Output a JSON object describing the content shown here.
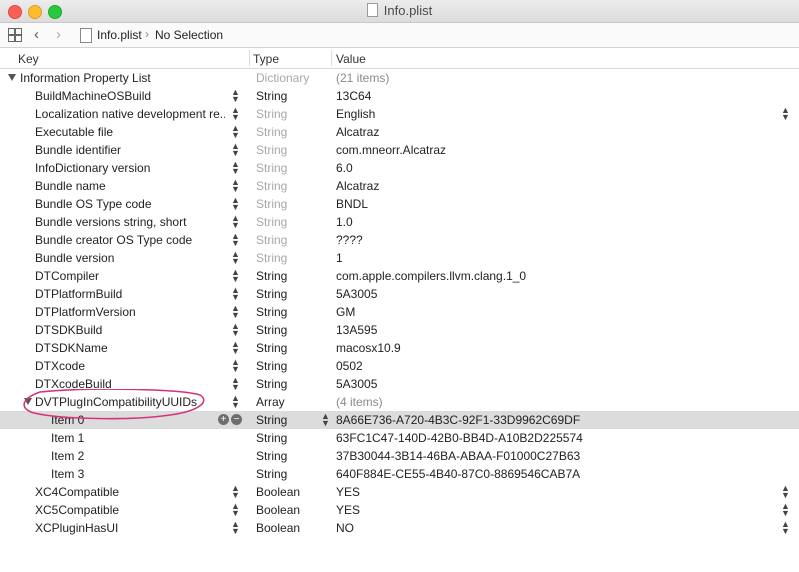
{
  "window": {
    "title": "Info.plist"
  },
  "jumpbar": {
    "file": "Info.plist",
    "separator": "›",
    "selection": "No Selection"
  },
  "columns": {
    "key": "Key",
    "type": "Type",
    "value": "Value"
  },
  "rows": [
    {
      "key": "Information Property List",
      "type": "Dictionary",
      "value": "(21 items)"
    },
    {
      "key": "BuildMachineOSBuild",
      "type": "String",
      "value": "13C64"
    },
    {
      "key": "Localization native development re...",
      "type": "String",
      "value": "English"
    },
    {
      "key": "Executable file",
      "type": "String",
      "value": "Alcatraz"
    },
    {
      "key": "Bundle identifier",
      "type": "String",
      "value": "com.mneorr.Alcatraz"
    },
    {
      "key": "InfoDictionary version",
      "type": "String",
      "value": "6.0"
    },
    {
      "key": "Bundle name",
      "type": "String",
      "value": "Alcatraz"
    },
    {
      "key": "Bundle OS Type code",
      "type": "String",
      "value": "BNDL"
    },
    {
      "key": "Bundle versions string, short",
      "type": "String",
      "value": "1.0"
    },
    {
      "key": "Bundle creator OS Type code",
      "type": "String",
      "value": "????"
    },
    {
      "key": "Bundle version",
      "type": "String",
      "value": "1"
    },
    {
      "key": "DTCompiler",
      "type": "String",
      "value": "com.apple.compilers.llvm.clang.1_0"
    },
    {
      "key": "DTPlatformBuild",
      "type": "String",
      "value": "5A3005"
    },
    {
      "key": "DTPlatformVersion",
      "type": "String",
      "value": "GM"
    },
    {
      "key": "DTSDKBuild",
      "type": "String",
      "value": "13A595"
    },
    {
      "key": "DTSDKName",
      "type": "String",
      "value": "macosx10.9"
    },
    {
      "key": "DTXcode",
      "type": "String",
      "value": "0502"
    },
    {
      "key": "DTXcodeBuild",
      "type": "String",
      "value": "5A3005"
    },
    {
      "key": "DVTPlugInCompatibilityUUIDs",
      "type": "Array",
      "value": "(4 items)"
    },
    {
      "key": "Item 0",
      "type": "String",
      "value": "8A66E736-A720-4B3C-92F1-33D9962C69DF"
    },
    {
      "key": "Item 1",
      "type": "String",
      "value": "63FC1C47-140D-42B0-BB4D-A10B2D225574"
    },
    {
      "key": "Item 2",
      "type": "String",
      "value": "37B30044-3B14-46BA-ABAA-F01000C27B63"
    },
    {
      "key": "Item 3",
      "type": "String",
      "value": "640F884E-CE55-4B40-87C0-8869546CAB7A"
    },
    {
      "key": "XC4Compatible",
      "type": "Boolean",
      "value": "YES"
    },
    {
      "key": "XC5Compatible",
      "type": "Boolean",
      "value": "YES"
    },
    {
      "key": "XCPluginHasUI",
      "type": "Boolean",
      "value": "NO"
    }
  ],
  "colors": {
    "annotation": "#d6337a",
    "selected_row": "#dcdcdc"
  },
  "icons": [
    "grid-icon",
    "back-arrow-icon",
    "forward-arrow-icon",
    "file-icon",
    "disclosure-triangle-icon",
    "stepper-icon",
    "add-icon",
    "remove-icon"
  ]
}
